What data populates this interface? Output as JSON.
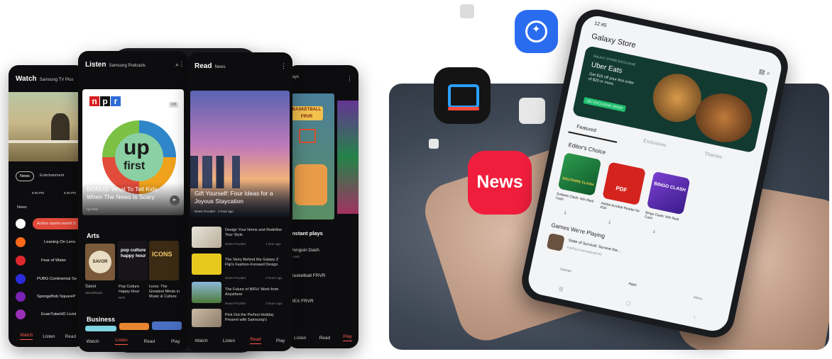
{
  "brand": {
    "accent": "#ff5a4c",
    "news_red": "#f01e3c",
    "bixby_blue": "#2a6cf0"
  },
  "watch": {
    "title": "Watch",
    "subtitle": "Samsung TV Plus",
    "chips": [
      "News",
      "Entertainment",
      "E"
    ],
    "times": [
      "6:00 PM",
      "6:30 PM"
    ],
    "section": "News",
    "channels": [
      "Action sports world S",
      "Leaning On Lens",
      "Fear of Water",
      "PUBG Continental Se",
      "SpongeBob SquareP",
      "EvanTubeHD Livist"
    ],
    "tabs": [
      "Watch",
      "Listen",
      "Read"
    ]
  },
  "listen": {
    "title": "Listen",
    "subtitle": "Samsung Podcasts",
    "npr": [
      "n",
      "p",
      "r"
    ],
    "upfirst": [
      "up",
      "first"
    ],
    "episode": "BONUS: What To Tell Kids When The News Is Scary",
    "episode_source": "Up First",
    "badge": "1/8",
    "section_arts": "Arts",
    "arts": [
      {
        "cover": "SAVOR",
        "title": "Savor",
        "meta": "eBookRadio"
      },
      {
        "cover": "pop culture happy hour",
        "title": "Pop Culture Happy Hour",
        "meta": "NPR"
      },
      {
        "cover": "ICONS",
        "title": "Icons: The Greatest Minds in Music & Culture",
        "meta": ""
      }
    ],
    "section_business": "Business",
    "tabs": [
      "Watch",
      "Listen",
      "Read",
      "Play"
    ]
  },
  "read": {
    "title": "Read",
    "subtitle": "News",
    "hero_title": "Gift Yourself: Four Ideas for a Joyous Staycation",
    "hero_meta": "News Provider · 1 hour ago",
    "articles": [
      {
        "title": "Design Your Home and Redefine Your Style",
        "source": "News Provider",
        "time": "1 hour ago"
      },
      {
        "title": "The Story Behind the Galaxy Z Flip's Fashion-Forward Design",
        "source": "News Provider",
        "time": "3 hours ago"
      },
      {
        "title": "The Future of WFH: Work from Anywhere",
        "source": "News Provider",
        "time": "3 hours ago"
      },
      {
        "title": "Pick Out the Perfect Holiday Present with Samsung's",
        "source": "",
        "time": ""
      }
    ],
    "tabs": [
      "Watch",
      "Listen",
      "Read",
      "Play"
    ]
  },
  "play": {
    "title": "plays",
    "tile1": "BASKETBALL FRVR",
    "section": "Instant plays",
    "games": [
      {
        "title": "Penguin Dash",
        "meta": "GAME"
      },
      {
        "title": "Basketball FRVR",
        "meta": ""
      },
      {
        "title": "HEX FRVR",
        "meta": ""
      }
    ],
    "tabs": [
      "Listen",
      "Read",
      "Play"
    ]
  },
  "news_icon": {
    "label": "News"
  },
  "galaxy_store": {
    "time": "12:45",
    "title": "Galaxy Store",
    "promo_tag": "GALAXY STORE EXCLUSIVE",
    "promo_title": "Uber Eats",
    "promo_text": "Get $15 off your first order of $20 or more.",
    "promo_button": "GET EXCLUSIVE OFFER",
    "tabs": [
      "Featured",
      "Exclusives",
      "Themes"
    ],
    "editors_choice": "Editor's Choice",
    "apps": [
      {
        "icon": "SOLITAIRE CLASH",
        "name": "Solitaire Clash: Win Real Cash"
      },
      {
        "icon": "PDF",
        "name": "Adobe Acrobat Reader for PDF"
      },
      {
        "icon": "BINGO CLASH",
        "name": "Bingo Clash: Win Real Cash"
      }
    ],
    "games_playing": "Games We're Playing",
    "game_item": "State of Survival: Survive the...",
    "game_item_meta": "FunPlus International AG",
    "bottom_nav": [
      "Games",
      "Apps",
      "Menu"
    ]
  }
}
